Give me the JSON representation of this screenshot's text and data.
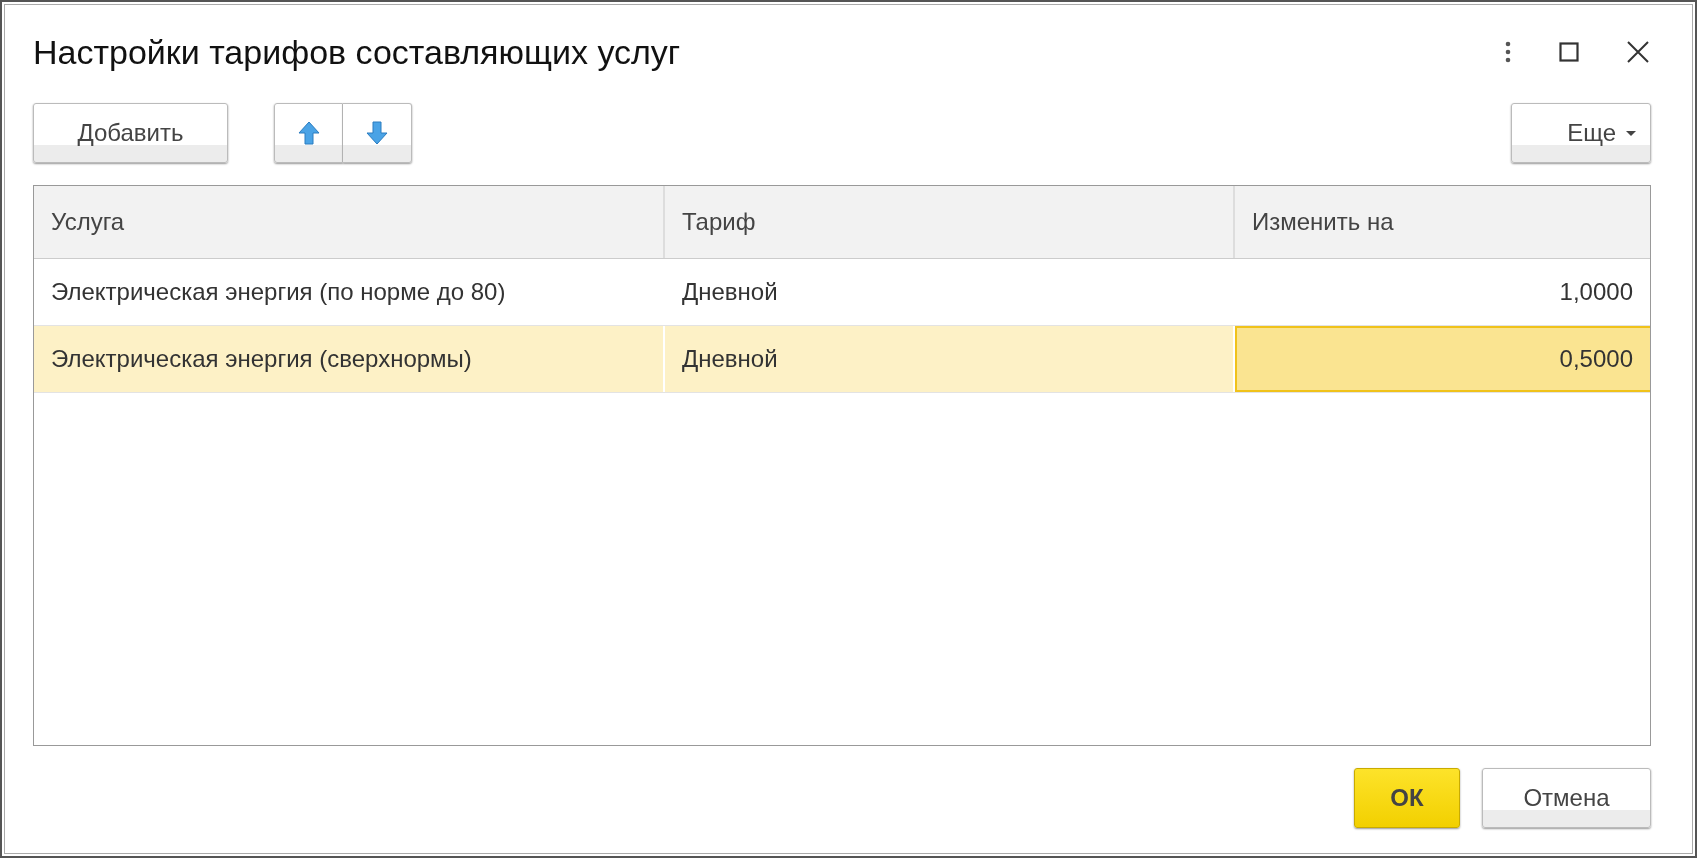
{
  "window": {
    "title": "Настройки тарифов составляющих услуг"
  },
  "toolbar": {
    "add_button": "Добавить",
    "more_button": "Еще"
  },
  "table": {
    "columns": [
      "Услуга",
      "Тариф",
      "Изменить на"
    ],
    "rows": [
      {
        "service": "Электрическая энергия (по норме до 80)",
        "tariff": "Дневной",
        "value": "1,0000",
        "selected": false,
        "value_focused": false
      },
      {
        "service": "Электрическая энергия (сверхнормы)",
        "tariff": "Дневной",
        "value": "0,5000",
        "selected": true,
        "value_focused": true
      }
    ]
  },
  "footer": {
    "ok_button": "ОК",
    "cancel_button": "Отмена"
  }
}
